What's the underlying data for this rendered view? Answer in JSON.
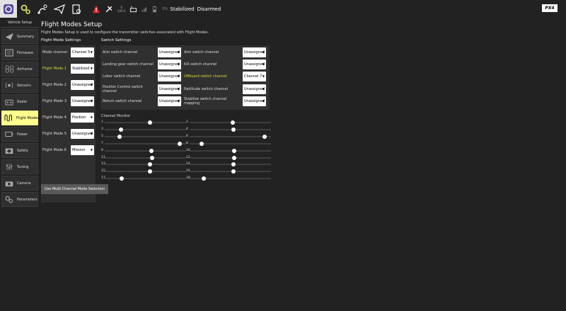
{
  "toolbar": {
    "flight_mode": "Stabilized",
    "armed_state": "Disarmed",
    "gps_count": "0",
    "gps_hdop": "100.0",
    "logo": "PX4"
  },
  "sidebar": {
    "header": "Vehicle Setup",
    "items": [
      {
        "label": "Summary"
      },
      {
        "label": "Firmware"
      },
      {
        "label": "Airframe"
      },
      {
        "label": "Sensors"
      },
      {
        "label": "Radio"
      },
      {
        "label": "Flight Modes"
      },
      {
        "label": "Power"
      },
      {
        "label": "Safety"
      },
      {
        "label": "Tuning"
      },
      {
        "label": "Camera"
      },
      {
        "label": "Parameters"
      }
    ]
  },
  "page": {
    "title": "Flight Modes Setup",
    "description": "Flight Modes Setup is used to configure the transmitter switches associated with Flight Modes.",
    "fm_section": "Flight Mode Settings",
    "sw_section": "Switch Settings",
    "cm_section": "Channel Monitor",
    "multi_button": "Use Multi Channel Mode Selection"
  },
  "flight_modes": {
    "rows": [
      {
        "label": "Mode channel",
        "value": "Channel 5"
      },
      {
        "label": "Flight Mode 1",
        "value": "Stabilized"
      },
      {
        "label": "Flight Mode 2",
        "value": "Unassigned"
      },
      {
        "label": "Flight Mode 3",
        "value": "Unassigned"
      },
      {
        "label": "Flight Mode 4",
        "value": "Position"
      },
      {
        "label": "Flight Mode 5",
        "value": "Unassigned"
      },
      {
        "label": "Flight Mode 6",
        "value": "Mission"
      }
    ]
  },
  "switches": {
    "left": [
      {
        "label": "Arm switch channel",
        "value": "Unassigned"
      },
      {
        "label": "Landing gear switch channel",
        "value": "Unassigned"
      },
      {
        "label": "Loiter switch channel",
        "value": "Unassigned"
      },
      {
        "label": "Position Control switch channel",
        "value": "Unassigned"
      },
      {
        "label": "Return switch channel",
        "value": "Unassigned"
      }
    ],
    "right": [
      {
        "label": "Arm switch channel",
        "value": "Unassigned"
      },
      {
        "label": "Kill switch channel",
        "value": "Unassigned"
      },
      {
        "label": "Offboard switch channel",
        "value": "Channel 7"
      },
      {
        "label": "Rattitude switch channel",
        "value": "Unassigned"
      },
      {
        "label": "Stabilize switch channel mapping",
        "value": "Unassigned"
      }
    ]
  },
  "channels": {
    "left": [
      {
        "num": "1",
        "level": 0.56
      },
      {
        "num": "3",
        "level": 0.2
      },
      {
        "num": "5",
        "level": 0.18
      },
      {
        "num": "7",
        "level": 0.92
      },
      {
        "num": "9",
        "level": 0.57
      },
      {
        "num": "11",
        "level": 0.58
      },
      {
        "num": "13",
        "level": 0.56
      },
      {
        "num": "15",
        "level": 0.56
      },
      {
        "num": "17",
        "level": 0.21
      }
    ],
    "right": [
      {
        "num": "2",
        "level": 0.53
      },
      {
        "num": "4",
        "level": 0.54
      },
      {
        "num": "6",
        "level": 0.92
      },
      {
        "num": "8",
        "level": 0.15
      },
      {
        "num": "10",
        "level": 0.55
      },
      {
        "num": "12",
        "level": 0.55
      },
      {
        "num": "14",
        "level": 0.54
      },
      {
        "num": "16",
        "level": 0.54
      },
      {
        "num": "18",
        "level": 0.17
      }
    ]
  }
}
